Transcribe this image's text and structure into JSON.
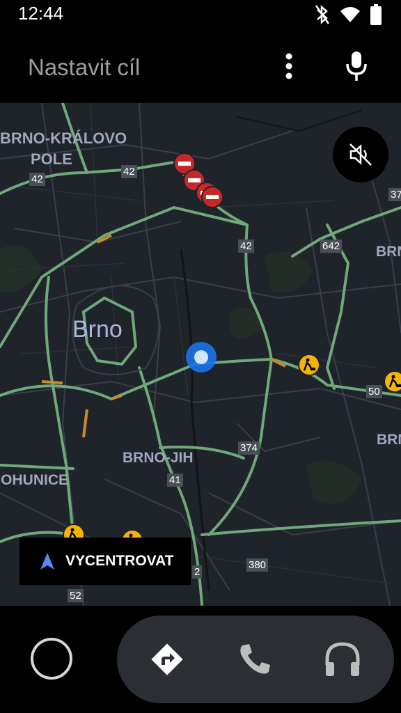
{
  "status_bar": {
    "time": "12:44",
    "icons": [
      "bluetooth-icon",
      "wifi-icon",
      "battery-icon"
    ]
  },
  "top_bar": {
    "search_label": "Nastavit cíl",
    "icons": [
      "more-vert-icon",
      "microphone-icon"
    ]
  },
  "map": {
    "city_label": "Brno",
    "district_labels": [
      "BRNO-KRÁLOVO",
      "POLE",
      "BRNO-JIH",
      "BOHUNICE",
      "BRN",
      "BRN"
    ],
    "road_shields": [
      "42",
      "42",
      "42",
      "642",
      "374",
      "41",
      "50",
      "380",
      "52",
      "37",
      "2"
    ],
    "mute_button_icon": "volume-off-icon",
    "recenter_label": "VYCENTROVAT",
    "colors": {
      "background": "#1f232a",
      "road_major": "#6fa97a",
      "incident_red": "#c62828",
      "roadwork_yellow": "#f4b400",
      "location_blue": "#1a73e8"
    }
  },
  "bottom_bar": {
    "icons": [
      "home-circle-icon",
      "navigation-icon",
      "phone-icon",
      "headphones-icon"
    ]
  }
}
